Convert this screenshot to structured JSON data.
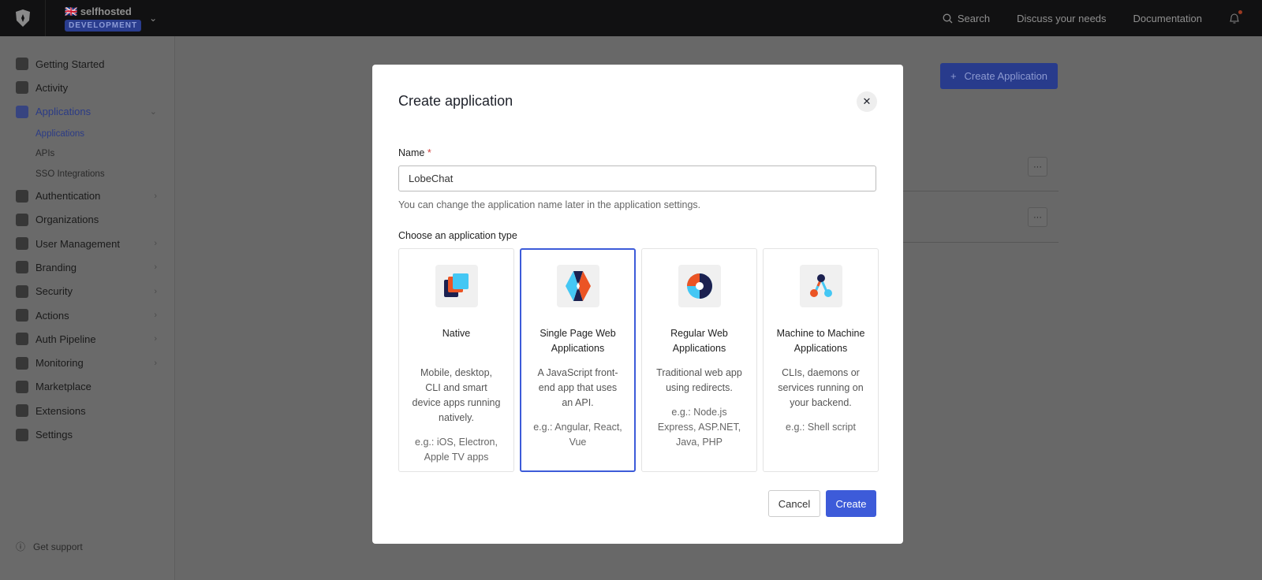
{
  "topbar": {
    "tenant": "selfhosted",
    "environment": "DEVELOPMENT",
    "search": "Search",
    "discuss": "Discuss your needs",
    "docs": "Documentation"
  },
  "sidebar": {
    "items": [
      {
        "label": "Getting Started"
      },
      {
        "label": "Activity"
      },
      {
        "label": "Applications"
      },
      {
        "label": "Authentication"
      },
      {
        "label": "Organizations"
      },
      {
        "label": "User Management"
      },
      {
        "label": "Branding"
      },
      {
        "label": "Security"
      },
      {
        "label": "Actions"
      },
      {
        "label": "Auth Pipeline"
      },
      {
        "label": "Monitoring"
      },
      {
        "label": "Marketplace"
      },
      {
        "label": "Extensions"
      },
      {
        "label": "Settings"
      }
    ],
    "sub": [
      "Applications",
      "APIs",
      "SSO Integrations"
    ],
    "support": "Get support"
  },
  "main": {
    "create_button": "Create Application",
    "row_menu": "···"
  },
  "modal": {
    "title": "Create application",
    "name_label": "Name",
    "required": "*",
    "name_value": "LobeChat",
    "help": "You can change the application name later in the application settings.",
    "choose_label": "Choose an application type",
    "types": [
      {
        "title": "Native",
        "desc": "Mobile, desktop, CLI and smart device apps running natively.",
        "example": "e.g.: iOS, Electron, Apple TV apps"
      },
      {
        "title": "Single Page Web Applications",
        "desc": "A JavaScript front-end app that uses an API.",
        "example": "e.g.: Angular, React, Vue"
      },
      {
        "title": "Regular Web Applications",
        "desc": "Traditional web app using redirects.",
        "example": "e.g.: Node.js Express, ASP.NET, Java, PHP"
      },
      {
        "title": "Machine to Machine Applications",
        "desc": "CLIs, daemons or services running on your backend.",
        "example": "e.g.: Shell script"
      }
    ],
    "cancel": "Cancel",
    "create": "Create"
  },
  "colors": {
    "accent": "#3d5bd9",
    "topbar": "#1b1b1d"
  }
}
